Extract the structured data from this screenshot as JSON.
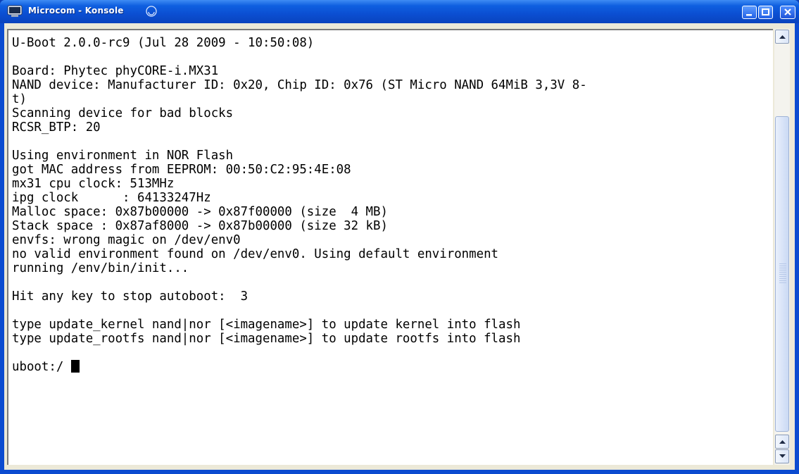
{
  "window": {
    "title": "Microcom - Konsole",
    "controls": [
      "minimize",
      "maximize",
      "close"
    ]
  },
  "terminal": {
    "lines": [
      "U-Boot 2.0.0-rc9 (Jul 28 2009 - 10:50:08)",
      "",
      "Board: Phytec phyCORE-i.MX31",
      "NAND device: Manufacturer ID: 0x20, Chip ID: 0x76 (ST Micro NAND 64MiB 3,3V 8-",
      "t)",
      "Scanning device for bad blocks",
      "RCSR_BTP: 20",
      "",
      "Using environment in NOR Flash",
      "got MAC address from EEPROM: 00:50:C2:95:4E:08",
      "mx31 cpu clock: 513MHz",
      "ipg clock      : 64133247Hz",
      "Malloc space: 0x87b00000 -> 0x87f00000 (size  4 MB)",
      "Stack space : 0x87af8000 -> 0x87b00000 (size 32 kB)",
      "envfs: wrong magic on /dev/env0",
      "no valid environment found on /dev/env0. Using default environment",
      "running /env/bin/init...",
      "",
      "Hit any key to stop autoboot:  3",
      "",
      "type update_kernel nand|nor [<imagename>] to update kernel into flash",
      "type update_rootfs nand|nor [<imagename>] to update rootfs into flash",
      ""
    ],
    "prompt": "uboot:/ "
  }
}
